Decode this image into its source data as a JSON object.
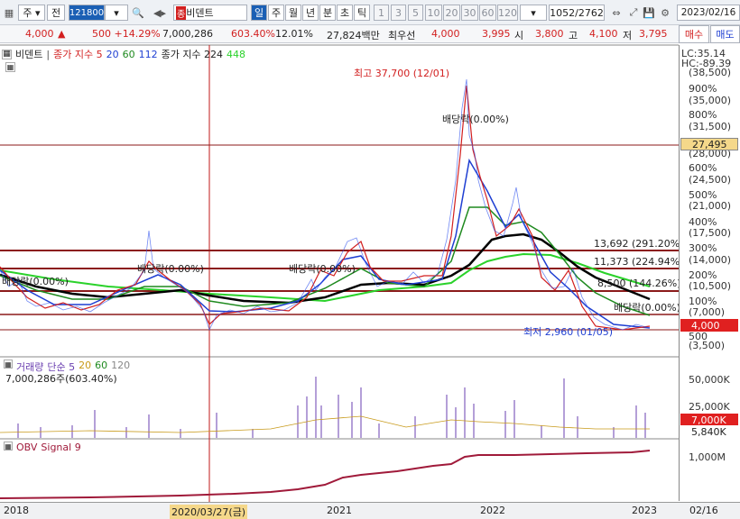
{
  "toolbar": {
    "type_select": "주",
    "prev_label": "전",
    "code": "121800",
    "stock_name": "비덴트",
    "period_tabs": [
      "일",
      "주",
      "월",
      "년",
      "분",
      "초",
      "틱"
    ],
    "numbers": [
      "1",
      "3",
      "5",
      "10",
      "20",
      "30",
      "60",
      "120"
    ],
    "count": "1052/2762",
    "date": "2023/02/16"
  },
  "quote": {
    "price": "4,000",
    "change": "500 +14.29%",
    "volume": "7,000,286",
    "vol_ratio": "603.40%",
    "turnover": "12.01%",
    "amount": "27,824백만",
    "priority_label": "최우선",
    "priority_ask": "4,000",
    "priority_bid": "3,995",
    "open_label": "시",
    "open": "3,800",
    "high_label": "고",
    "high": "4,100",
    "low_label": "저",
    "low": "3,795"
  },
  "buttons": {
    "buy": "매수",
    "sell": "매도"
  },
  "price_panel": {
    "legend_name": "비덴트",
    "legend_ma": "종가 지수 5",
    "ma_20": "20",
    "ma_60": "60",
    "ma_112": "112",
    "legend_ma2": "종가 지수 224",
    "ma_448": "448",
    "lc": "LC:35.14",
    "hc": "HC:-89.39",
    "high_note": "최고 37,700 (12/01)",
    "low_note": "최저 2,960 (01/05)",
    "div_notes": [
      "배당락(0.00%)",
      "배당락(0.00%)",
      "배당락(0.00%)",
      "배당락(0.00%)",
      "배당락(0.00%)"
    ],
    "levels": [
      {
        "label": "13,692 (291.20%)",
        "value": 13692
      },
      {
        "label": "11,373 (224.94%)",
        "value": 11373
      },
      {
        "label": "8,500 (144.26%)",
        "value": 8500
      }
    ],
    "current_marker": "27,495",
    "price_marker": "4,000",
    "axis_labels": [
      "(38,500)",
      "900%",
      "(35,000)",
      "800%",
      "(31,500)",
      "(28,000)",
      "600%",
      "(24,500)",
      "500%",
      "(21,000)",
      "400%",
      "(17,500)",
      "300%",
      "(14,000)",
      "200%",
      "(10,500)",
      "100%",
      "(7,000)",
      "500",
      "(3,500)"
    ],
    "axis_labels_title": "price scale"
  },
  "volume_panel": {
    "legend": "거래량",
    "ma_label": "단순 5",
    "ma_20": "20",
    "ma_60": "60",
    "ma_120": "120",
    "value": "7,000,286주(603.40%)",
    "axis": [
      "50,000K",
      "25,000K"
    ],
    "marker": "7,000K",
    "marker2": "5,840K"
  },
  "obv_panel": {
    "legend": "OBV",
    "signal": "Signal 9",
    "axis": "1,000M"
  },
  "x_axis": {
    "labels": [
      "2018",
      "2020/03/27(금)",
      "2021",
      "2022",
      "2023"
    ],
    "right": "02/16"
  },
  "colors": {
    "ma5": "#d21f1f",
    "ma20": "#1f3fd2",
    "ma60": "#1f8a1f",
    "ma112": "#000000",
    "ma448": "#2ad22a",
    "level_line": "#8b1a1a"
  }
}
